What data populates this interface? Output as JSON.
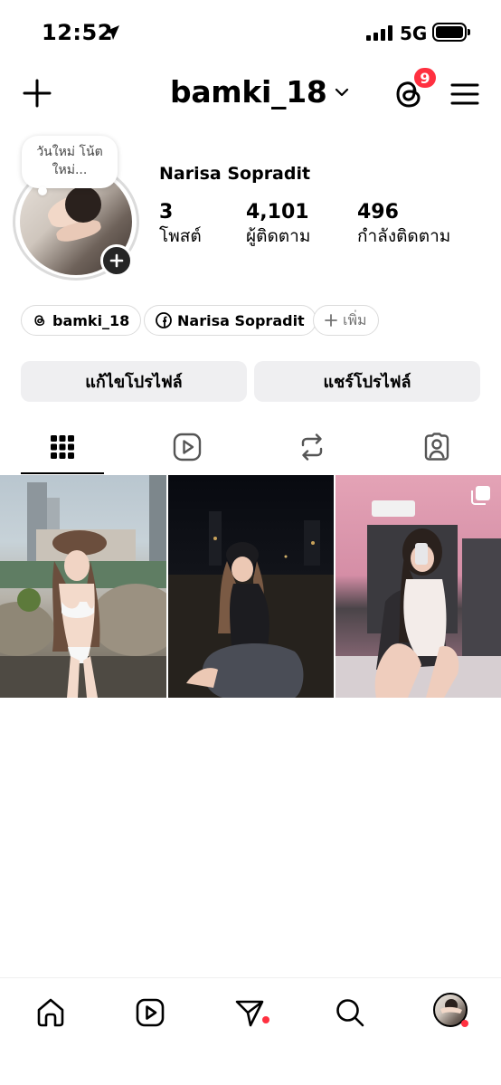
{
  "status_bar": {
    "time": "12:52",
    "network": "5G"
  },
  "header": {
    "username": "bamki_18",
    "notification_count": "9"
  },
  "profile": {
    "note": "วันใหม่ โน้ตใหม่...",
    "full_name": "Narisa Sopradit",
    "stats": [
      {
        "value": "3",
        "label": "โพสต์"
      },
      {
        "value": "4,101",
        "label": "ผู้ติดตาม"
      },
      {
        "value": "496",
        "label": "กำลังติดตาม"
      }
    ]
  },
  "chips": {
    "threads": "bamki_18",
    "facebook": "Narisa Sopradit",
    "add": "เพิ่ม"
  },
  "buttons": {
    "edit_profile": "แก้ไขโปรไฟล์",
    "share_profile": "แชร์โปรไฟล์"
  },
  "tabs": [
    "grid-icon",
    "reels-icon",
    "reposts-icon",
    "tagged-icon"
  ],
  "posts": [
    "post-1",
    "post-2",
    "post-3"
  ],
  "nav": [
    "home-icon",
    "reels-icon",
    "send-icon",
    "search-icon",
    "profile-avatar"
  ],
  "colors": {
    "badge": "#ff3040",
    "button_bg": "#efeff1",
    "text": "#000000"
  }
}
